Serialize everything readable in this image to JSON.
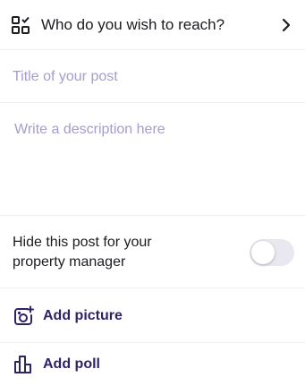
{
  "audience": {
    "label": "Who do you wish to reach?",
    "icon": "audience-grid-icon",
    "chevron_icon": "chevron-right-icon"
  },
  "post": {
    "title_placeholder": "Title of your post",
    "title_value": "",
    "description_placeholder": "Write a description here",
    "description_value": ""
  },
  "privacy": {
    "hide_label": "Hide this post for your property manager",
    "toggle_on": false
  },
  "actions": {
    "add_picture_label": "Add picture",
    "add_picture_icon": "add-camera-icon",
    "add_poll_label": "Add poll",
    "add_poll_icon": "poll-icon"
  },
  "colors": {
    "text": "#1d1b20",
    "placeholder": "#a69ccd",
    "accent": "#2d2466",
    "divider": "#eeeeee",
    "toggle_off": "#e9e7ef"
  }
}
